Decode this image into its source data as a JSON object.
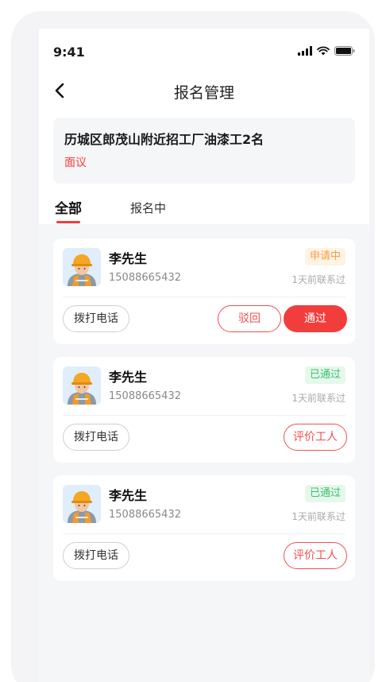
{
  "status_bar": {
    "time": "9:41"
  },
  "nav": {
    "title": "报名管理"
  },
  "job": {
    "title": "历城区郎茂山附近招工厂油漆工2名",
    "salary": "面议"
  },
  "tabs": [
    {
      "label": "全部",
      "active": true
    },
    {
      "label": "报名中",
      "active": false
    }
  ],
  "applicants": [
    {
      "name": "李先生",
      "phone": "15088665432",
      "status": "申请中",
      "contact_time": "1天前联系过",
      "call_label": "拨打电话",
      "reject_label": "驳回",
      "pass_label": "通过"
    },
    {
      "name": "李先生",
      "phone": "15088665432",
      "status": "已通过",
      "contact_time": "1天前联系过",
      "call_label": "拨打电话",
      "rate_label": "评价工人"
    },
    {
      "name": "李先生",
      "phone": "15088665432",
      "status": "已通过",
      "contact_time": "1天前联系过",
      "call_label": "拨打电话",
      "rate_label": "评价工人"
    }
  ],
  "colors": {
    "accent": "#f23d3d",
    "pending": "#f5a04a",
    "passed": "#35c46a",
    "background": "#f5f6f8"
  }
}
